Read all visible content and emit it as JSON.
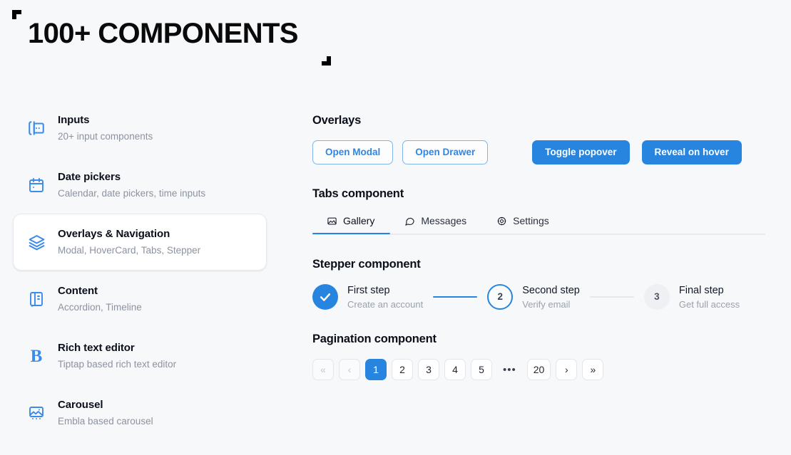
{
  "page": {
    "title": "100+ COMPONENTS",
    "accent_color": "#2785e0",
    "icon_color": "#3b8bea",
    "background_color": "#f7f8fa"
  },
  "sidebar": {
    "items": [
      {
        "icon": "input-cursor-icon",
        "title": "Inputs",
        "subtitle": "20+ input components",
        "active": false
      },
      {
        "icon": "calendar-icon",
        "title": "Date pickers",
        "subtitle": "Calendar, date pickers, time inputs",
        "active": false
      },
      {
        "icon": "layers-icon",
        "title": "Overlays & Navigation",
        "subtitle": "Modal, HoverCard, Tabs, Stepper",
        "active": true
      },
      {
        "icon": "notebook-icon",
        "title": "Content",
        "subtitle": "Accordion, Timeline",
        "active": false
      },
      {
        "icon": "bold-letter-icon",
        "title": "Rich text editor",
        "subtitle": "Tiptap based rich text editor",
        "active": false
      },
      {
        "icon": "image-carousel-icon",
        "title": "Carousel",
        "subtitle": "Embla based carousel",
        "active": false
      }
    ]
  },
  "main": {
    "overlays": {
      "title": "Overlays",
      "buttons": [
        {
          "label": "Open Modal",
          "style": "outline"
        },
        {
          "label": "Open Drawer",
          "style": "outline"
        },
        {
          "label": "Toggle popover",
          "style": "solid"
        },
        {
          "label": "Reveal on hover",
          "style": "solid"
        }
      ]
    },
    "tabs": {
      "title": "Tabs component",
      "items": [
        {
          "label": "Gallery",
          "icon": "image-icon",
          "active": true
        },
        {
          "label": "Messages",
          "icon": "message-circle-icon",
          "active": false
        },
        {
          "label": "Settings",
          "icon": "gear-icon",
          "active": false
        }
      ]
    },
    "stepper": {
      "title": "Stepper component",
      "steps": [
        {
          "marker": "check-icon",
          "state": "done",
          "label": "First step",
          "description": "Create an account"
        },
        {
          "marker": "2",
          "state": "current",
          "label": "Second step",
          "description": "Verify email"
        },
        {
          "marker": "3",
          "state": "todo",
          "label": "Final step",
          "description": "Get full access"
        }
      ],
      "connectors": [
        "filled",
        "empty"
      ]
    },
    "pagination": {
      "title": "Pagination component",
      "items": [
        {
          "label": "«",
          "name": "first-page",
          "state": "disabled"
        },
        {
          "label": "‹",
          "name": "prev-page",
          "state": "disabled"
        },
        {
          "label": "1",
          "name": "page-1",
          "state": "active"
        },
        {
          "label": "2",
          "name": "page-2",
          "state": "normal"
        },
        {
          "label": "3",
          "name": "page-3",
          "state": "normal"
        },
        {
          "label": "4",
          "name": "page-4",
          "state": "normal"
        },
        {
          "label": "5",
          "name": "page-5",
          "state": "normal"
        },
        {
          "label": "•••",
          "name": "page-ellipsis",
          "state": "ellipsis"
        },
        {
          "label": "20",
          "name": "page-20",
          "state": "normal"
        },
        {
          "label": "›",
          "name": "next-page",
          "state": "normal"
        },
        {
          "label": "»",
          "name": "last-page",
          "state": "normal"
        }
      ]
    }
  }
}
